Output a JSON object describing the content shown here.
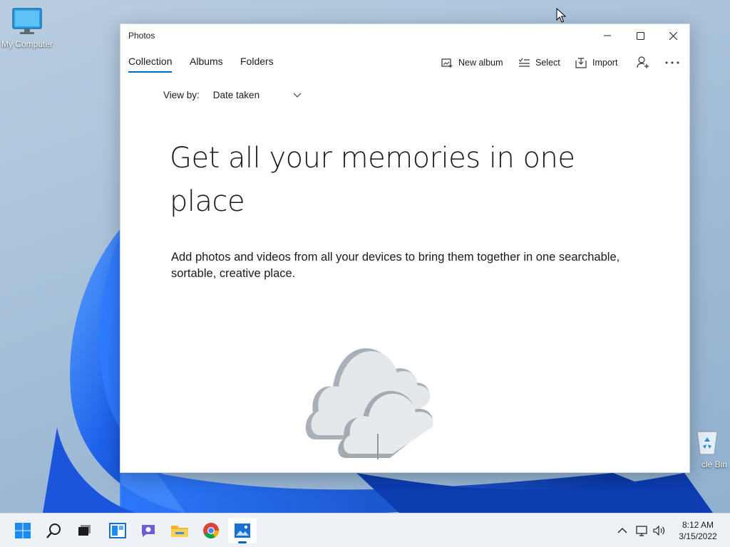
{
  "desktop": {
    "icons": [
      {
        "label": "My Computer",
        "icon": "monitor-icon"
      },
      {
        "label": "cle Bin",
        "icon": "recycle-bin-icon"
      }
    ]
  },
  "window": {
    "title": "Photos",
    "controls": {
      "minimize": "minimize-icon",
      "maximize": "maximize-icon",
      "close": "close-icon"
    }
  },
  "nav": {
    "tabs": [
      {
        "label": "Collection",
        "active": true
      },
      {
        "label": "Albums",
        "active": false
      },
      {
        "label": "Folders",
        "active": false
      }
    ],
    "actions": [
      {
        "label": "New album",
        "icon": "new-album-icon"
      },
      {
        "label": "Select",
        "icon": "select-list-icon"
      },
      {
        "label": "Import",
        "icon": "import-icon"
      }
    ],
    "account_icon": "add-account-icon",
    "more_icon": "more-options-icon"
  },
  "view_by": {
    "label": "View by:",
    "value": "Date taken"
  },
  "empty_state": {
    "headline": "Get all your memories in one place",
    "description": "Add photos and videos from all your devices to bring them together in one searchable, sortable, creative place.",
    "illustration": "cloud-illustration"
  },
  "taskbar": {
    "apps": [
      "start-icon",
      "search-icon",
      "task-view-icon",
      "widgets-icon",
      "chat-icon",
      "file-explorer-icon",
      "chrome-icon",
      "photos-icon"
    ],
    "active_app": "photos-icon",
    "tray": [
      "chevron-up-icon",
      "network-icon",
      "volume-icon"
    ],
    "time": "8:12 AM",
    "date": "3/15/2022"
  },
  "colors": {
    "accent": "#0067c0",
    "wallpaper_blue": "#1e63e9"
  }
}
